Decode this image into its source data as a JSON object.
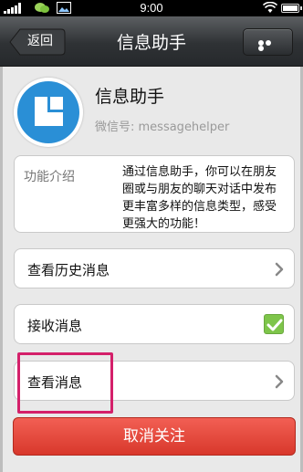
{
  "status_bar": {
    "time": "9:00"
  },
  "nav": {
    "back_label": "返回",
    "title": "信息助手"
  },
  "profile": {
    "name": "信息助手",
    "wechat_id": "微信号: messagehelper"
  },
  "intro": {
    "label": "功能介绍",
    "description": "通过信息助手，你可以在朋友圈或与朋友的聊天对话中发布更丰富多样的信息类型，感受更强大的功能！"
  },
  "rows": {
    "history": "查看历史消息",
    "receive": "接收消息",
    "view": "查看消息"
  },
  "toggle_state": {
    "receive_checked": true
  },
  "unfollow_label": "取消关注",
  "colors": {
    "nav_bg": "#2f3235",
    "avatar_blue": "#2a8fd6",
    "checkbox_green": "#7ec54a",
    "unfollow_red": "#d8382c",
    "highlight_pink": "#d4206a"
  },
  "icons": {
    "status": [
      "signal-icon",
      "wechat-icon",
      "image-icon",
      "wifi-icon",
      "battery-icon"
    ],
    "nav": [
      "back-arrow-icon",
      "more-dots-icon"
    ],
    "rows": [
      "chevron-right-icon",
      "checkbox-checked-icon"
    ]
  }
}
